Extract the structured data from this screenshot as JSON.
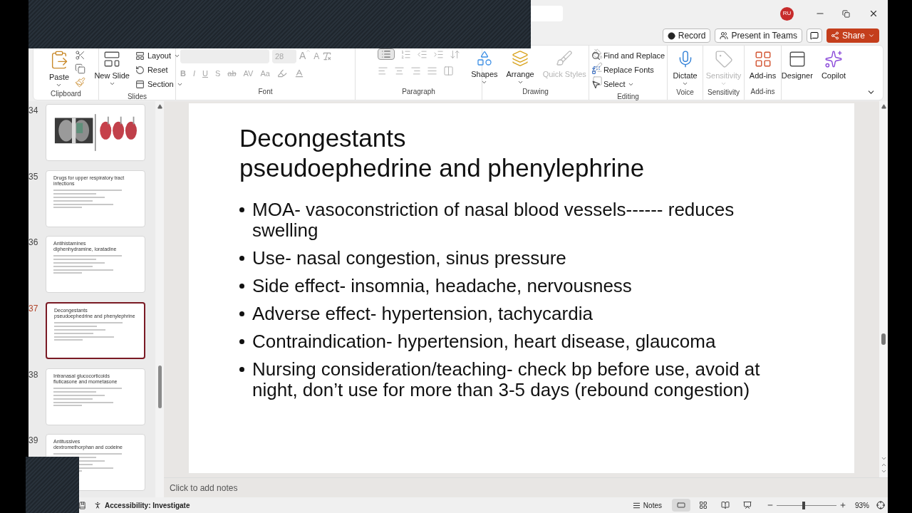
{
  "title_bar": {
    "account_initials": "RU"
  },
  "command_bar": {
    "buttons": [
      {
        "kind": "record",
        "label": "Record"
      },
      {
        "kind": "teams",
        "label": "Present in Teams"
      },
      {
        "kind": "comment"
      },
      {
        "kind": "share",
        "label": "Share"
      }
    ]
  },
  "ribbon": {
    "groups": [
      {
        "kind": "clipboard",
        "label": "Clipboard",
        "items": [
          {
            "label": "Paste",
            "disabled": false
          }
        ]
      },
      {
        "kind": "slides",
        "label": "Slides",
        "items": [
          {
            "label": "New Slide",
            "disabled": false
          },
          {
            "label": "Layout",
            "disabled": false
          },
          {
            "label": "Reset",
            "disabled": false
          },
          {
            "label": "Section",
            "disabled": false
          }
        ]
      },
      {
        "kind": "font",
        "label": "Font",
        "disabled": true,
        "font_size": "28",
        "grow": "A",
        "shrink": "A",
        "buttons": [
          "B",
          "I",
          "U",
          "S",
          "ab",
          "AV",
          "Aa"
        ]
      },
      {
        "kind": "paragraph",
        "label": "Paragraph"
      },
      {
        "kind": "drawing",
        "label": "Drawing",
        "items": [
          {
            "label": "Shapes",
            "disabled": false
          },
          {
            "label": "Arrange",
            "disabled": false
          },
          {
            "label": "Quick Styles",
            "disabled": true
          }
        ]
      },
      {
        "kind": "editing",
        "label": "Editing",
        "items": [
          {
            "label": "Find and Replace",
            "disabled": false
          },
          {
            "label": "Replace Fonts",
            "disabled": false
          },
          {
            "label": "Select",
            "disabled": false
          }
        ]
      },
      {
        "kind": "voice",
        "label": "Voice",
        "items": [
          {
            "label": "Dictate",
            "disabled": false
          }
        ]
      },
      {
        "kind": "sensitivity",
        "label": "Sensitivity",
        "items": [
          {
            "label": "Sensitivity",
            "disabled": true
          }
        ]
      },
      {
        "kind": "addins",
        "label": "Add-ins",
        "items": [
          {
            "label": "Add-ins",
            "disabled": false
          }
        ]
      },
      {
        "kind": "ai",
        "items": [
          {
            "label": "Designer",
            "disabled": false
          },
          {
            "label": "Copilot",
            "disabled": false
          }
        ]
      }
    ]
  },
  "thumbnails": [
    {
      "number": "34",
      "kind": "picture",
      "selected": false
    },
    {
      "number": "35",
      "kind": "text",
      "selected": false,
      "title": [
        "Drugs for upper respiratory tract infections"
      ]
    },
    {
      "number": "36",
      "kind": "text",
      "selected": false,
      "title": [
        "Antihistamines",
        "diphenhydramine, loratadine"
      ]
    },
    {
      "number": "37",
      "kind": "text",
      "selected": true,
      "title": [
        "Decongestants",
        "pseudoephedrine and phenylephrine"
      ]
    },
    {
      "number": "38",
      "kind": "text",
      "selected": false,
      "title": [
        "Intranasal glucocorticoids",
        "fluticasone and mometasone"
      ]
    },
    {
      "number": "39",
      "kind": "text",
      "selected": false,
      "title": [
        "Antitussives",
        "dextromethorphan and codeine"
      ]
    }
  ],
  "slide": {
    "title": [
      "Decongestants",
      "pseudoephedrine and phenylephrine"
    ],
    "bullets": [
      "MOA- vasoconstriction of nasal blood vessels------ reduces swelling",
      "Use- nasal congestion, sinus pressure",
      "Side effect- insomnia, headache, nervousness",
      "Adverse effect- hypertension, tachycardia",
      "Contraindication- hypertension, heart disease, glaucoma",
      "Nursing consideration/teaching- check bp before use, avoid at night, don’t use for more than 3-5 days (rebound congestion)"
    ]
  },
  "notes": {
    "placeholder": "Click to add notes"
  },
  "status_bar": {
    "accessibility": "Accessibility: Investigate",
    "notes_button": "Notes",
    "views": [
      {
        "kind": "normal",
        "selected": true
      },
      {
        "kind": "sorter",
        "selected": false
      },
      {
        "kind": "reading",
        "selected": false
      },
      {
        "kind": "slideshow",
        "selected": false
      }
    ],
    "zoom_slider": {
      "level": 0.45
    },
    "zoom": "93%"
  }
}
